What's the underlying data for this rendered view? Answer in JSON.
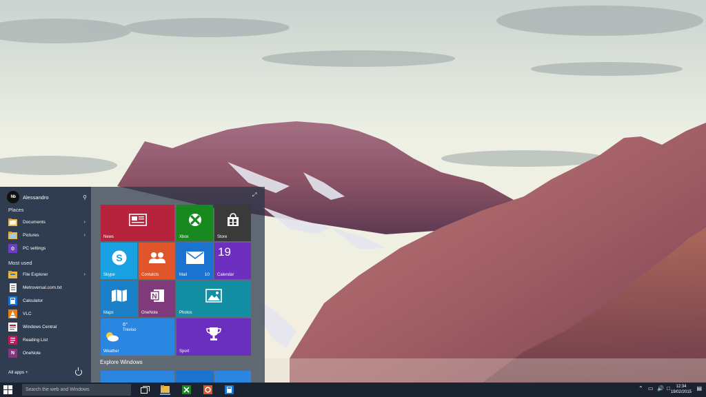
{
  "start_menu": {
    "user_name": "Alessandro",
    "user_avatar_text": "Nb",
    "places_heading": "Places",
    "places": [
      {
        "label": "Documents",
        "icon": "folder-icon"
      },
      {
        "label": "Pictures",
        "icon": "folder-icon"
      },
      {
        "label": "PC settings",
        "icon": "gear-icon"
      }
    ],
    "most_used_heading": "Most used",
    "most_used": [
      {
        "label": "File Explorer",
        "icon": "folder-icon"
      },
      {
        "label": "Metroversal.com.txt",
        "icon": "document-icon"
      },
      {
        "label": "Calculator",
        "icon": "calculator-icon"
      },
      {
        "label": "VLC",
        "icon": "vlc-icon"
      },
      {
        "label": "Windows Central",
        "icon": "windows-central-icon"
      },
      {
        "label": "Reading List",
        "icon": "reading-list-icon"
      },
      {
        "label": "OneNote",
        "icon": "onenote-icon"
      }
    ],
    "all_apps": "All apps +",
    "explore_heading": "Explore Windows",
    "tiles": {
      "news": "News",
      "xbox": "Xbox",
      "store": "Store",
      "skype": "Skype",
      "contacts": "Contatcts",
      "mail": "Mail",
      "mail_badge": "10",
      "calendar": "Calendar",
      "calendar_day": "19",
      "maps": "Maps",
      "onenote": "OneNote",
      "photos": "Photos",
      "weather": "Weather",
      "weather_temp": "6°",
      "weather_city": "Treviso",
      "sport": "Sport"
    },
    "tile_colors": {
      "news": "#b7223d",
      "xbox": "#18891f",
      "store": "#3a3a3a",
      "skype": "#1aa1e2",
      "contacts": "#e0552a",
      "mail": "#1c73cf",
      "calendar": "#6d2fbf",
      "maps": "#1a80c8",
      "onenote": "#80397b",
      "photos": "#148ea3",
      "weather": "#2a86e0",
      "sport": "#6a2fbf"
    }
  },
  "taskbar": {
    "search_placeholder": "Search the web and Windows",
    "time": "12:34",
    "date": "19/02/2015"
  }
}
